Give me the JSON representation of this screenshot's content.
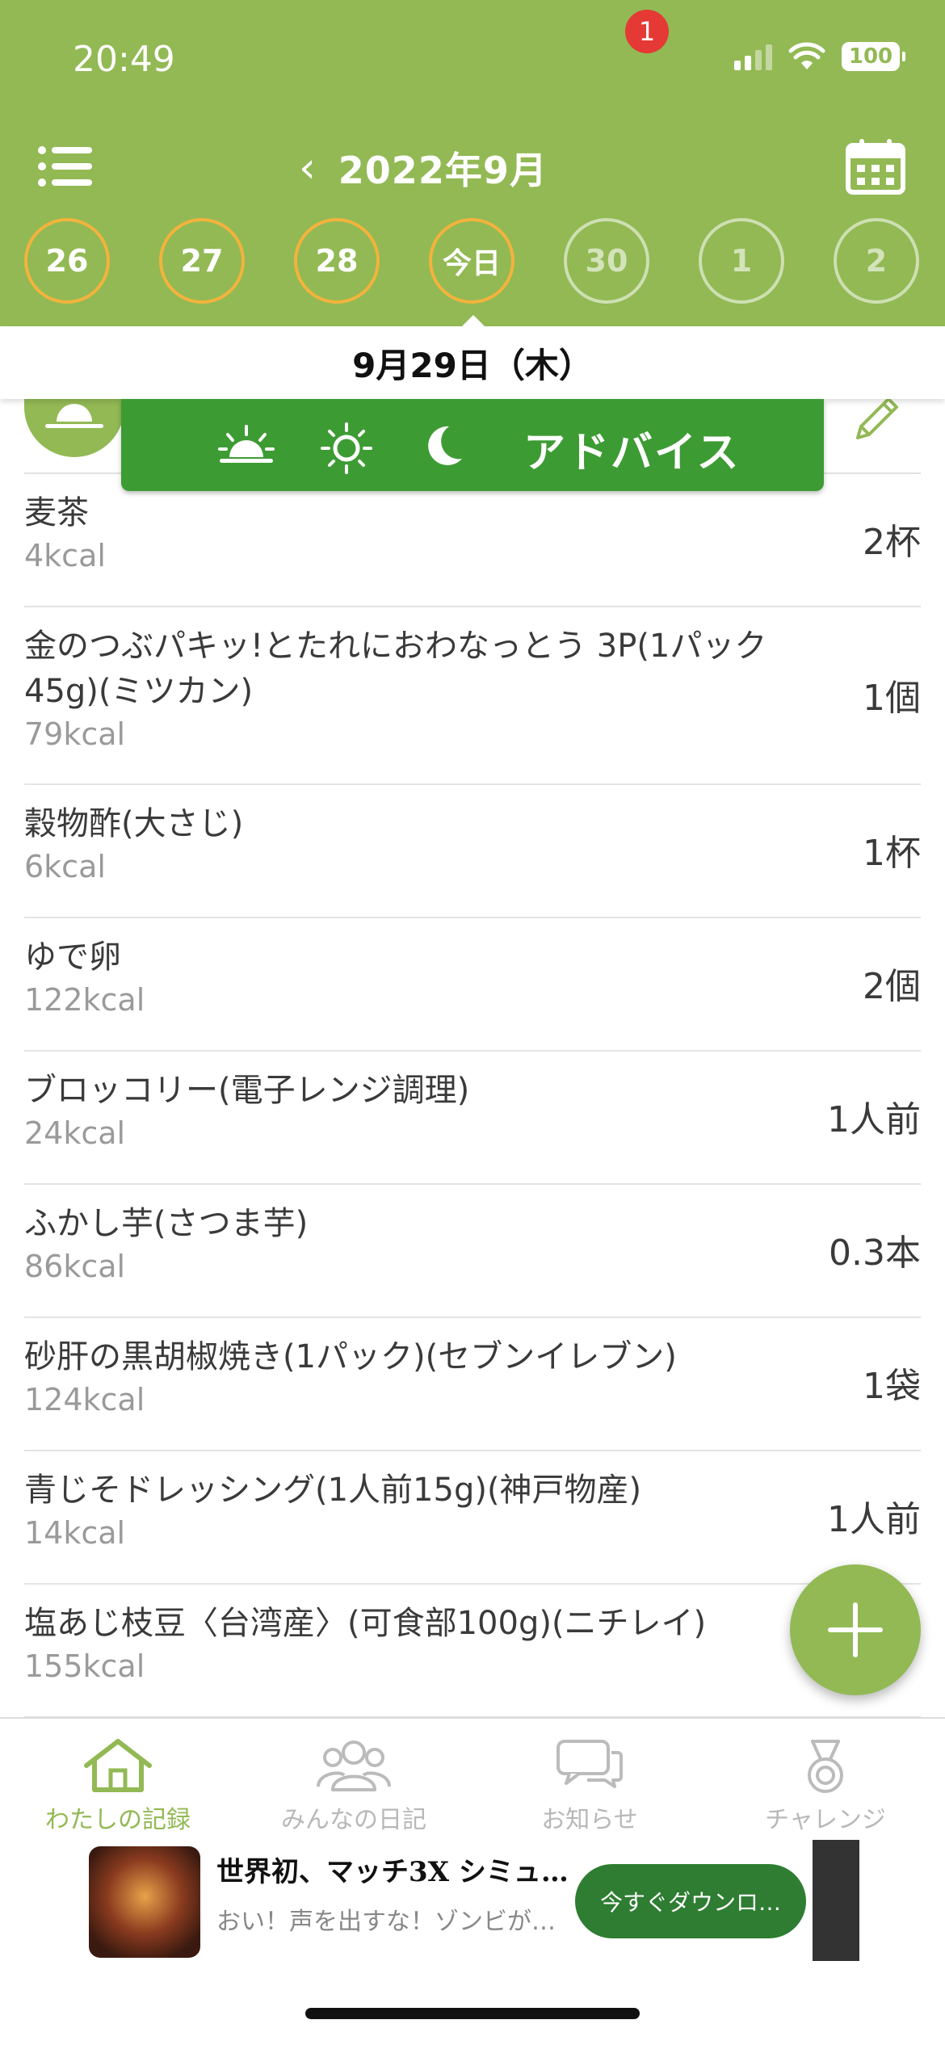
{
  "status_bar": {
    "time": "20:49",
    "battery": "100"
  },
  "header": {
    "month_title": "2022年9月"
  },
  "day_strip": [
    {
      "label": "26",
      "state": "past"
    },
    {
      "label": "27",
      "state": "past"
    },
    {
      "label": "28",
      "state": "past"
    },
    {
      "label": "今日",
      "state": "today"
    },
    {
      "label": "30",
      "state": "future"
    },
    {
      "label": "1",
      "state": "future"
    },
    {
      "label": "2",
      "state": "future"
    }
  ],
  "selected_date": "9月29日（木）",
  "advice_label": "アドバイス",
  "foods": [
    {
      "name": "麦茶",
      "kcal": "4kcal",
      "qty": "2杯"
    },
    {
      "name": "金のつぶパキッ!とたれにおわなっとう 3P(1パック45g)(ミツカン)",
      "kcal": "79kcal",
      "qty": "1個"
    },
    {
      "name": "穀物酢(大さじ)",
      "kcal": "6kcal",
      "qty": "1杯"
    },
    {
      "name": "ゆで卵",
      "kcal": "122kcal",
      "qty": "2個"
    },
    {
      "name": "ブロッコリー(電子レンジ調理)",
      "kcal": "24kcal",
      "qty": "1人前"
    },
    {
      "name": "ふかし芋(さつま芋)",
      "kcal": "86kcal",
      "qty": "0.3本"
    },
    {
      "name": "砂肝の黒胡椒焼き(1パック)(セブンイレブン)",
      "kcal": "124kcal",
      "qty": "1袋"
    },
    {
      "name": "青じそドレッシング(1人前15g)(神戸物産)",
      "kcal": "14kcal",
      "qty": "1人前"
    },
    {
      "name": "塩あじ枝豆〈台湾産〉(可食部100g)(ニチレイ)",
      "kcal": "155kcal",
      "qty": ""
    }
  ],
  "tabs": [
    {
      "label": "わたしの記録",
      "icon": "home-icon",
      "active": true
    },
    {
      "label": "みんなの日記",
      "icon": "people-icon",
      "active": false
    },
    {
      "label": "お知らせ",
      "icon": "chat-icon",
      "active": false
    },
    {
      "label": "チャレンジ",
      "icon": "medal-icon",
      "active": false
    }
  ],
  "notification_count": "1",
  "ad": {
    "title": "世界初、マッチ3X シミュ…",
    "subtitle": "おい！声を出すな！ゾンビが…",
    "cta": "今すぐダウンロ…"
  },
  "colors": {
    "brand_green": "#92b954",
    "advice_green": "#3d9b33",
    "ring_orange": "#f3b33d",
    "badge_red": "#e53935"
  }
}
